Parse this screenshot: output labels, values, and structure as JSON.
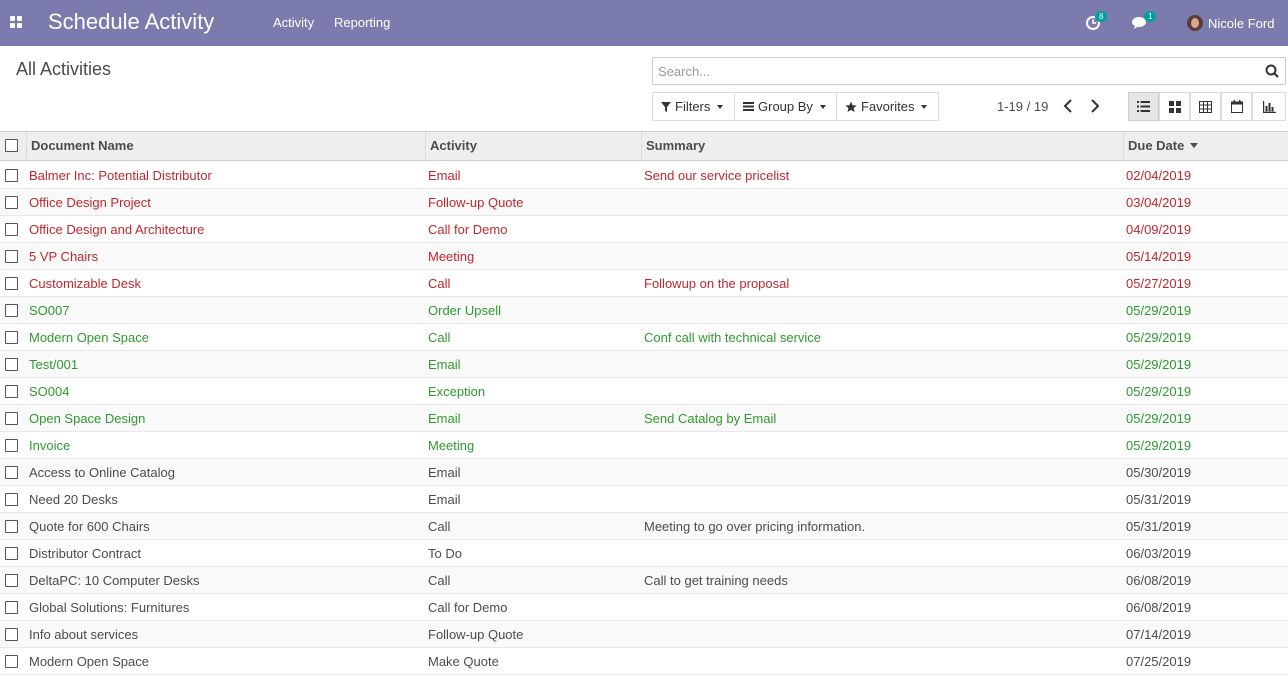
{
  "navbar": {
    "title": "Schedule Activity",
    "menu": [
      "Activity",
      "Reporting"
    ],
    "activity_badge": "8",
    "messages_badge": "1",
    "user": "Nicole Ford"
  },
  "control_panel": {
    "breadcrumb": "All Activities",
    "search_placeholder": "Search...",
    "filters_label": "Filters",
    "groupby_label": "Group By",
    "favorites_label": "Favorites",
    "pager": "1-19 / 19"
  },
  "table": {
    "headers": [
      "Document Name",
      "Activity",
      "Summary",
      "Due Date"
    ],
    "rows": [
      {
        "doc": "Balmer Inc: Potential Distributor",
        "activity": "Email",
        "summary": "Send our service pricelist",
        "date": "02/04/2019",
        "status": "overdue"
      },
      {
        "doc": "Office Design Project",
        "activity": "Follow-up Quote",
        "summary": "",
        "date": "03/04/2019",
        "status": "overdue"
      },
      {
        "doc": "Office Design and Architecture",
        "activity": "Call for Demo",
        "summary": "",
        "date": "04/09/2019",
        "status": "overdue"
      },
      {
        "doc": "5 VP Chairs",
        "activity": "Meeting",
        "summary": "",
        "date": "05/14/2019",
        "status": "overdue"
      },
      {
        "doc": "Customizable Desk",
        "activity": "Call",
        "summary": "Followup on the proposal",
        "date": "05/27/2019",
        "status": "overdue"
      },
      {
        "doc": "SO007",
        "activity": "Order Upsell",
        "summary": "",
        "date": "05/29/2019",
        "status": "today"
      },
      {
        "doc": "Modern Open Space",
        "activity": "Call",
        "summary": "Conf call with technical service",
        "date": "05/29/2019",
        "status": "today"
      },
      {
        "doc": "Test/001",
        "activity": "Email",
        "summary": "",
        "date": "05/29/2019",
        "status": "today"
      },
      {
        "doc": "SO004",
        "activity": "Exception",
        "summary": "",
        "date": "05/29/2019",
        "status": "today"
      },
      {
        "doc": "Open Space Design",
        "activity": "Email",
        "summary": "Send Catalog by Email",
        "date": "05/29/2019",
        "status": "today"
      },
      {
        "doc": "Invoice",
        "activity": "Meeting",
        "summary": "",
        "date": "05/29/2019",
        "status": "today"
      },
      {
        "doc": "Access to Online Catalog",
        "activity": "Email",
        "summary": "",
        "date": "05/30/2019",
        "status": "planned"
      },
      {
        "doc": "Need 20 Desks",
        "activity": "Email",
        "summary": "",
        "date": "05/31/2019",
        "status": "planned"
      },
      {
        "doc": "Quote for 600 Chairs",
        "activity": "Call",
        "summary": "Meeting to go over pricing information.",
        "date": "05/31/2019",
        "status": "planned"
      },
      {
        "doc": "Distributor Contract",
        "activity": "To Do",
        "summary": "",
        "date": "06/03/2019",
        "status": "planned"
      },
      {
        "doc": "DeltaPC: 10 Computer Desks",
        "activity": "Call",
        "summary": "Call to get training needs",
        "date": "06/08/2019",
        "status": "planned"
      },
      {
        "doc": "Global Solutions: Furnitures",
        "activity": "Call for Demo",
        "summary": "",
        "date": "06/08/2019",
        "status": "planned"
      },
      {
        "doc": "Info about services",
        "activity": "Follow-up Quote",
        "summary": "",
        "date": "07/14/2019",
        "status": "planned"
      },
      {
        "doc": "Modern Open Space",
        "activity": "Make Quote",
        "summary": "",
        "date": "07/25/2019",
        "status": "planned"
      }
    ]
  }
}
